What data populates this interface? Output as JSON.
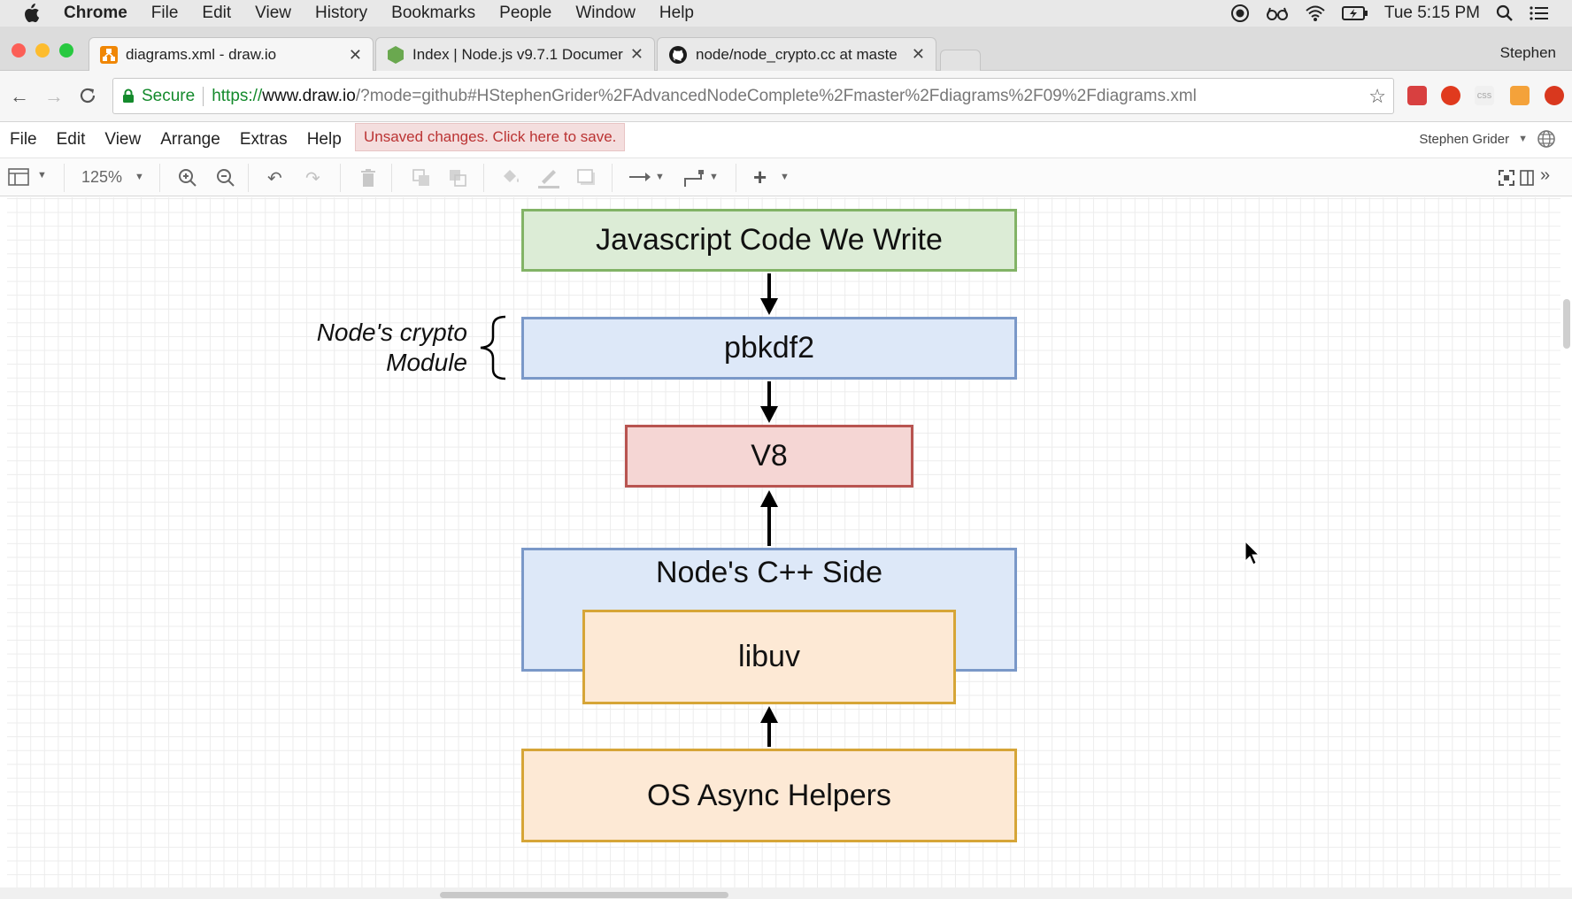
{
  "mac_menubar": {
    "app": "Chrome",
    "items": [
      "File",
      "Edit",
      "View",
      "History",
      "Bookmarks",
      "People",
      "Window",
      "Help"
    ],
    "clock": "Tue 5:15 PM"
  },
  "tabs": [
    {
      "title": "diagrams.xml - draw.io",
      "icon": "drawio-icon",
      "active": true
    },
    {
      "title": "Index | Node.js v9.7.1 Documer",
      "icon": "nodejs-icon",
      "active": false
    },
    {
      "title": "node/node_crypto.cc at maste",
      "icon": "github-icon",
      "active": false
    }
  ],
  "profile_name": "Stephen",
  "address_bar": {
    "secure_label": "Secure",
    "url_scheme": "https://",
    "url_host": "www.draw.io",
    "url_rest": "/?mode=github#HStephenGrider%2FAdvancedNodeComplete%2Fmaster%2Fdiagrams%2F09%2Fdiagrams.xml"
  },
  "drawio_menu": {
    "items": [
      "File",
      "Edit",
      "View",
      "Arrange",
      "Extras",
      "Help"
    ],
    "unsaved_notice": "Unsaved changes. Click here to save.",
    "user": "Stephen Grider"
  },
  "toolbar": {
    "zoom": "125%"
  },
  "diagram": {
    "nodes": {
      "js_code": "Javascript Code We Write",
      "pbkdf2": "pbkdf2",
      "v8": "V8",
      "cpp_side": "Node's C++ Side",
      "libuv": "libuv",
      "os_helpers": "OS Async Helpers"
    },
    "annotation_line1": "Node's crypto",
    "annotation_line2": "Module"
  },
  "colors": {
    "green_fill": "#dcecd6",
    "green_stroke": "#82b366",
    "blue_fill": "#dde8f8",
    "blue_stroke": "#7a98c8",
    "red_fill": "#f5d6d4",
    "red_stroke": "#b85450",
    "orange_fill": "#fde9d5",
    "orange_stroke": "#d6a537"
  }
}
